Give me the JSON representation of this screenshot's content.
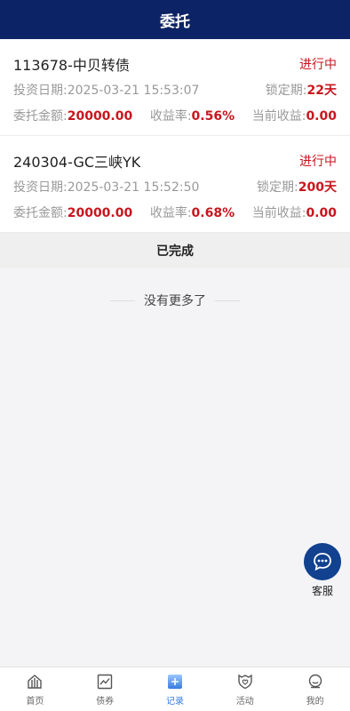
{
  "header": {
    "title": "委托"
  },
  "orders": [
    {
      "name": "113678-中贝转债",
      "status": "进行中",
      "date_label": "投资日期:",
      "date": "2025-03-21 15:53:07",
      "lock_label": "锁定期:",
      "lock": "22天",
      "amount_label": "委托金额:",
      "amount": "20000.00",
      "rate_label": "收益率:",
      "rate": "0.56%",
      "income_label": "当前收益:",
      "income": "0.00"
    },
    {
      "name": "240304-GC三峡YK",
      "status": "进行中",
      "date_label": "投资日期:",
      "date": "2025-03-21 15:52:50",
      "lock_label": "锁定期:",
      "lock": "200天",
      "amount_label": "委托金额:",
      "amount": "20000.00",
      "rate_label": "收益率:",
      "rate": "0.68%",
      "income_label": "当前收益:",
      "income": "0.00"
    }
  ],
  "completed": {
    "label": "已完成"
  },
  "no_more": "没有更多了",
  "service": {
    "label": "客服",
    "icon": "chat-icon"
  },
  "tabbar": {
    "items": [
      {
        "label": "首页",
        "icon": "home-icon"
      },
      {
        "label": "债券",
        "icon": "chart-icon"
      },
      {
        "label": "记录",
        "icon": "plus-icon"
      },
      {
        "label": "活动",
        "icon": "heart-badge-icon"
      },
      {
        "label": "我的",
        "icon": "user-chat-icon"
      }
    ],
    "active_index": 2
  },
  "colors": {
    "header_bg": "#0c2466",
    "accent_red": "#c8161d",
    "service_bg": "#11418f",
    "tab_active": "#3a7be0"
  }
}
